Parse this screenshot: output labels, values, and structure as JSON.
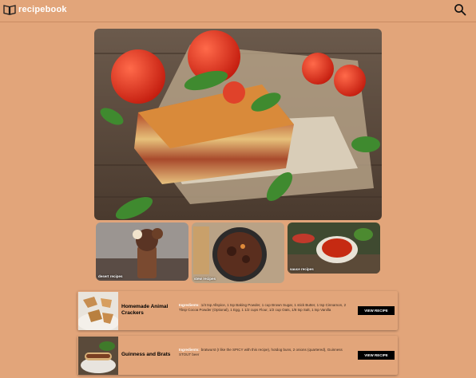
{
  "header": {
    "brand": "recipebook",
    "logo_icon": "open-book-icon",
    "search_icon": "search-icon"
  },
  "categories": [
    {
      "label": "desert recipes"
    },
    {
      "label": "stew recipes"
    },
    {
      "label": "sauce recipes"
    }
  ],
  "recipes": [
    {
      "title": "Homemade Animal Crackers",
      "ingredients_label": "Ingredients:",
      "ingredients": "1/4 tsp Allspice, 1 tsp Baking Powder, 1 cup Brown Sugar, 1 stick Butter, 1 tsp Cinnamon, 2 Tbsp Cocoa Powder (Optional), 1 Egg, 1 1/2 cups Flour, 1/2 cup Oats, 1/8 tsp Salt, 1 tsp Vanilla",
      "button": "VIEW RECIPE"
    },
    {
      "title": "Guinness and Brats",
      "ingredients_label": "Ingredients:",
      "ingredients": "bratwurst (I like the SPICY with this recipe), hotdog buns, 2 onions (quartered), Guinness STOUT beer",
      "button": "VIEW RECIPE"
    }
  ],
  "colors": {
    "background": "#e2a57a",
    "button": "#000000",
    "brand_text": "#ffffff"
  }
}
